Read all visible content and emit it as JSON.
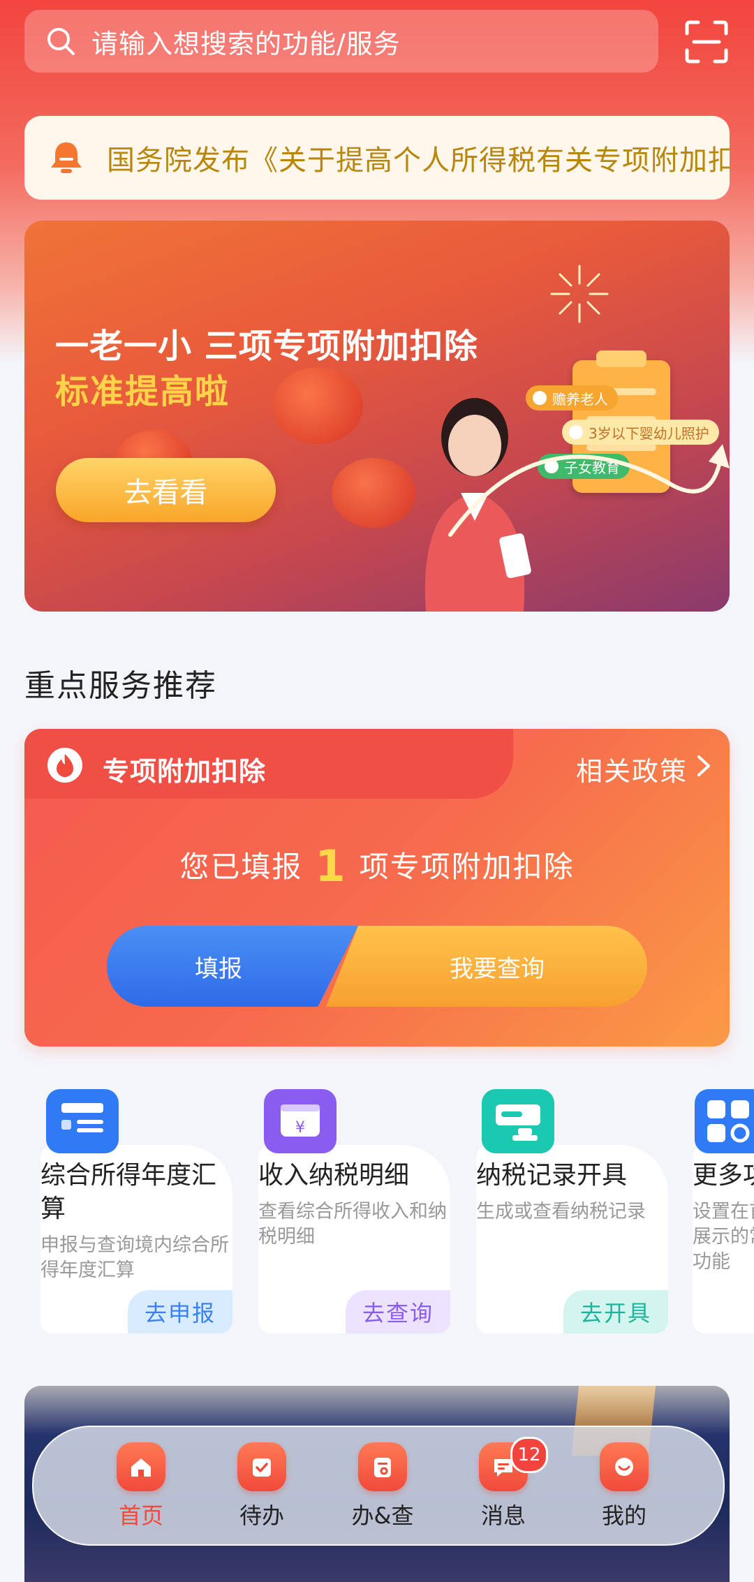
{
  "search": {
    "placeholder": "请输入想搜索的功能/服务"
  },
  "notice": {
    "text": "国务院发布《关于提高个人所得税有关专项附加扣除标准的通知》"
  },
  "banner": {
    "title_line1": "一老一小 三项专项附加扣除",
    "title_line2": "标准提高啦",
    "button": "去看看",
    "tags": [
      "赡养老人",
      "3岁以下婴幼儿照护",
      "子女教育"
    ]
  },
  "section_title": "重点服务推荐",
  "special_card": {
    "title": "专项附加扣除",
    "policy_link": "相关政策",
    "msg_prefix": "您已填报",
    "count": "1",
    "msg_suffix": "项专项附加扣除",
    "btn_fill": "填报",
    "btn_query": "我要查询"
  },
  "services": [
    {
      "name": "综合所得年度汇算",
      "desc": "申报与查询境内综合所得年度汇算",
      "action": "去申报",
      "icon": "annual-summary-icon",
      "color": "#2f7bf5"
    },
    {
      "name": "收入纳税明细",
      "desc": "查看综合所得收入和纳税明细",
      "action": "去查询",
      "icon": "income-detail-icon",
      "color": "#8b5cf0"
    },
    {
      "name": "纳税记录开具",
      "desc": "生成或查看纳税记录",
      "action": "去开具",
      "icon": "tax-record-icon",
      "color": "#1bc8b0"
    },
    {
      "name": "更多功能",
      "desc": "设置在首页展示的常用功能",
      "action": "",
      "icon": "more-apps-icon",
      "color": "#2f7bf5"
    }
  ],
  "nav": {
    "items": [
      {
        "label": "首页",
        "icon": "home-icon"
      },
      {
        "label": "待办",
        "icon": "todo-icon"
      },
      {
        "label": "办&查",
        "icon": "handle-query-icon"
      },
      {
        "label": "消息",
        "icon": "message-icon"
      },
      {
        "label": "我的",
        "icon": "profile-icon"
      }
    ],
    "message_badge": "12",
    "active": "首页"
  }
}
